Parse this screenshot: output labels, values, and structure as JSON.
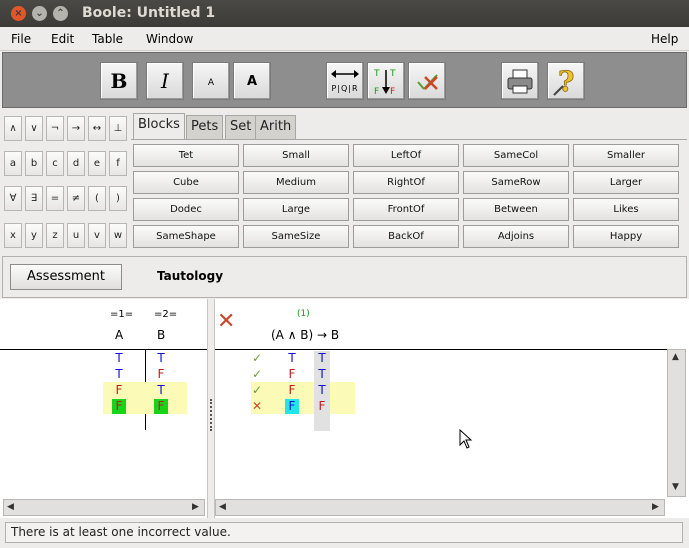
{
  "window": {
    "title": "Boole: Untitled 1",
    "close": "×",
    "minimize": "⌄",
    "maximize": "⌃"
  },
  "menu": {
    "file": "File",
    "edit": "Edit",
    "table": "Table",
    "window": "Window",
    "help": "Help"
  },
  "toolbar": {
    "bold": "B",
    "italic": "I",
    "font_small": "A",
    "font_large": "A",
    "pqr_label": "P|Q|R",
    "tf_label": "TF",
    "x_label": "✕"
  },
  "keypad": {
    "row1": [
      "∧",
      "∨",
      "¬",
      "→",
      "↔",
      "⊥"
    ],
    "row2": [
      "a",
      "b",
      "c",
      "d",
      "e",
      "f"
    ],
    "row3": [
      "∀",
      "∃",
      "=",
      "≠",
      "(",
      ")"
    ],
    "row4": [
      "x",
      "y",
      "z",
      "u",
      "v",
      "w"
    ]
  },
  "predicate_tabs": [
    "Blocks",
    "Pets",
    "Set",
    "Arith"
  ],
  "predicates": [
    [
      "Tet",
      "Small",
      "LeftOf",
      "SameCol",
      "Smaller"
    ],
    [
      "Cube",
      "Medium",
      "RightOf",
      "SameRow",
      "Larger"
    ],
    [
      "Dodec",
      "Large",
      "FrontOf",
      "Between",
      "Likes"
    ],
    [
      "SameShape",
      "SameSize",
      "BackOf",
      "Adjoins",
      "Happy"
    ]
  ],
  "assessment": {
    "button": "Assessment",
    "result": "Tautology"
  },
  "ref_columns": [
    {
      "ref": "=1=",
      "label": "A",
      "values": [
        "T",
        "T",
        "F",
        "F"
      ]
    },
    {
      "ref": "=2=",
      "label": "B",
      "values": [
        "T",
        "F",
        "T",
        "F"
      ]
    }
  ],
  "sentence": {
    "ref": "(1)",
    "formula": "(A ∧ B) → B",
    "status": "✕",
    "checks": [
      "✓",
      "✓",
      "✓",
      "✕"
    ],
    "main_col": [
      "T",
      "F",
      "F",
      "F"
    ],
    "conn_col": [
      "T",
      "T",
      "T",
      "F"
    ]
  },
  "status": "There is at least one incorrect value.",
  "colors": {
    "toolbar": "#8e8e8e",
    "highlight": "#fbfbb7",
    "green_cell": "#19d319",
    "cyan_cell": "#22e6e6",
    "wrong": "#c8482a",
    "check": "#6f9a3a"
  }
}
